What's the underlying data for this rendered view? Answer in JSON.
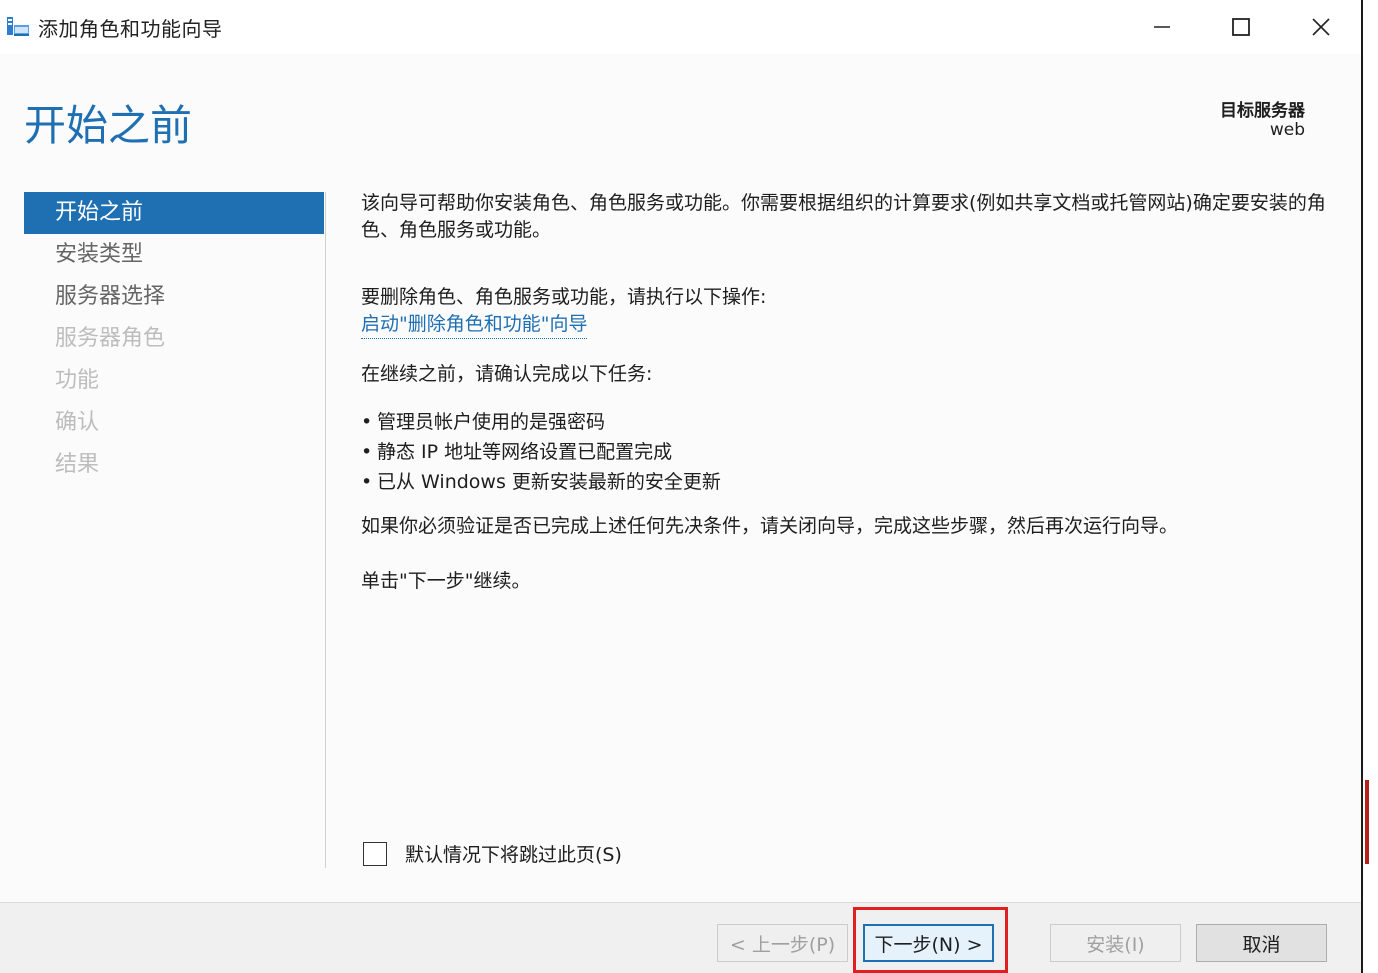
{
  "window": {
    "title": "添加角色和功能向导",
    "controls": {
      "minimize": "minimize",
      "maximize": "maximize",
      "close": "close"
    }
  },
  "header": {
    "page_title": "开始之前",
    "target_label": "目标服务器",
    "target_value": "web"
  },
  "nav": {
    "items": [
      {
        "label": "开始之前",
        "state": "active"
      },
      {
        "label": "安装类型",
        "state": "enabled"
      },
      {
        "label": "服务器选择",
        "state": "enabled"
      },
      {
        "label": "服务器角色",
        "state": "disabled"
      },
      {
        "label": "功能",
        "state": "disabled"
      },
      {
        "label": "确认",
        "state": "disabled"
      },
      {
        "label": "结果",
        "state": "disabled"
      }
    ]
  },
  "main": {
    "intro": "该向导可帮助你安装角色、角色服务或功能。你需要根据组织的计算要求(例如共享文档或托管网站)确定要安装的角色、角色服务或功能。",
    "remove_prompt": "要删除角色、角色服务或功能，请执行以下操作:",
    "remove_link": "启动\"删除角色和功能\"向导",
    "tasks_prompt": "在继续之前，请确认完成以下任务:",
    "tasks": [
      "管理员帐户使用的是强密码",
      "静态 IP 地址等网络设置已配置完成",
      "已从 Windows 更新安装最新的安全更新"
    ],
    "verify_note": "如果你必须验证是否已完成上述任何先决条件，请关闭向导，完成这些步骤，然后再次运行向导。",
    "continue_note": "单击\"下一步\"继续。"
  },
  "skip": {
    "label": "默认情况下将跳过此页(S)",
    "checked": false
  },
  "footer": {
    "prev_label": "< 上一步(P)",
    "next_label": "下一步(N) >",
    "install_label": "安装(I)",
    "cancel_label": "取消"
  },
  "colors": {
    "accent": "#1f6fb3",
    "highlight": "#e02020"
  }
}
